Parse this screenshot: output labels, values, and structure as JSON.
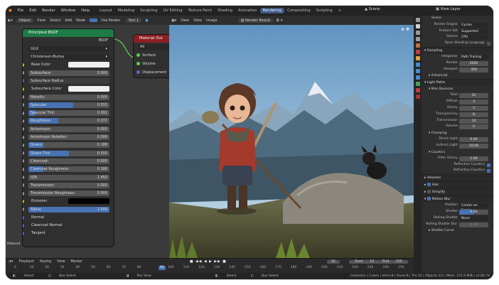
{
  "topbar": {
    "menu": [
      "File",
      "Edit",
      "Render",
      "Window",
      "Help"
    ],
    "workspaces": [
      "Layout",
      "Modeling",
      "Sculpting",
      "UV Editing",
      "Texture Paint",
      "Shading",
      "Animation",
      "Rendering",
      "Compositing",
      "Scripting"
    ],
    "active_workspace": "Rendering",
    "scene": "Scene",
    "view_layer": "View Layer"
  },
  "node_toolbar": {
    "object": "Object",
    "items": [
      "View",
      "Select",
      "Add",
      "Node"
    ],
    "use_nodes": "Use Nodes",
    "slot": "Slot 1"
  },
  "viewport_toolbar": {
    "items": [
      "View",
      "View",
      "Image"
    ],
    "render_result": "Render Result"
  },
  "bsdf_node": {
    "title": "Principled BSDF",
    "output": "BSDF",
    "dropdowns": [
      "GGX",
      "Christensen-Burley"
    ],
    "rows": [
      {
        "type": "color",
        "label": "Base Color",
        "socket": "#c7c729",
        "color": "#f0f0f0"
      },
      {
        "type": "field",
        "label": "Subsurface:",
        "value": "0.000",
        "fill": 0,
        "socket": "#a1a1a1"
      },
      {
        "type": "dd",
        "label": "Subsurface Radius",
        "socket": "#6363c7"
      },
      {
        "type": "color",
        "label": "Subsurface Color",
        "socket": "#c7c729",
        "color": "#f0f0f0"
      },
      {
        "type": "field",
        "label": "Metallic:",
        "value": "0.000",
        "fill": 0,
        "socket": "#a1a1a1"
      },
      {
        "type": "field",
        "label": "Specular:",
        "value": "0.555",
        "fill": 0.555,
        "socket": "#a1a1a1"
      },
      {
        "type": "field",
        "label": "Specular Tint:",
        "value": "0.091",
        "fill": 0.091,
        "socket": "#a1a1a1"
      },
      {
        "type": "field",
        "label": "Roughness:",
        "value": "0.372",
        "fill": 0.372,
        "socket": "#a1a1a1"
      },
      {
        "type": "field",
        "label": "Anisotropic:",
        "value": "0.000",
        "fill": 0,
        "socket": "#a1a1a1"
      },
      {
        "type": "field",
        "label": "Anisotropic Rotation:",
        "value": "0.000",
        "fill": 0,
        "socket": "#a1a1a1"
      },
      {
        "type": "field",
        "label": "Sheen:",
        "value": "0.188",
        "fill": 0.188,
        "socket": "#a1a1a1"
      },
      {
        "type": "field",
        "label": "Sheen Tint:",
        "value": "0.500",
        "fill": 0.5,
        "socket": "#a1a1a1"
      },
      {
        "type": "field",
        "label": "Clearcoat:",
        "value": "0.000",
        "fill": 0,
        "socket": "#a1a1a1"
      },
      {
        "type": "field",
        "label": "Clearcoat Roughness:",
        "value": "0.186",
        "fill": 0.186,
        "socket": "#a1a1a1"
      },
      {
        "type": "field",
        "label": "IOR:",
        "value": "1.450",
        "fill": 0,
        "socket": "#a1a1a1"
      },
      {
        "type": "field",
        "label": "Transmission:",
        "value": "0.000",
        "fill": 0,
        "socket": "#a1a1a1"
      },
      {
        "type": "field",
        "label": "Transmission Roughness:",
        "value": "0.000",
        "fill": 0,
        "socket": "#a1a1a1"
      },
      {
        "type": "color",
        "label": "Emission",
        "socket": "#c7c729",
        "color": "#000000"
      },
      {
        "type": "field",
        "label": "Alpha:",
        "value": "1.000",
        "fill": 1,
        "socket": "#a1a1a1"
      },
      {
        "type": "plain",
        "label": "Normal",
        "socket": "#6363c7"
      },
      {
        "type": "plain",
        "label": "Clearcoat Normal",
        "socket": "#6363c7"
      },
      {
        "type": "plain",
        "label": "Tangent",
        "socket": "#6363c7"
      }
    ]
  },
  "material_output": {
    "title": "Material Out",
    "target": "All",
    "sockets": [
      "Surface",
      "Volume",
      "Displacement"
    ]
  },
  "timeline": {
    "items": [
      "Playback",
      "Keying",
      "View",
      "Marker"
    ],
    "current": "92",
    "start_label": "Start",
    "start": "10",
    "end_label": "End",
    "end": "200",
    "ticks": [
      "0",
      "10",
      "20",
      "30",
      "40",
      "50",
      "60",
      "70",
      "80",
      "92",
      "100",
      "110",
      "120",
      "130",
      "140",
      "150",
      "160",
      "170",
      "180",
      "190",
      "200",
      "210",
      "220",
      "230",
      "240",
      "250"
    ]
  },
  "status": {
    "left": [
      "Select",
      "Box Select",
      "Pan View",
      "Select",
      "Box Select"
    ],
    "right": "Collection | Cubes | Verts:8 | Faces:6 | Tris:12 | Objects:1/3 | Mem: 155.9 MiB | v2.80.74"
  },
  "side_label": "Material",
  "props": {
    "scene": "Scene",
    "render_engine_label": "Render Engine",
    "render_engine": "Cycles",
    "feature_set_label": "Feature Set",
    "feature_set": "Supported",
    "device_label": "Device",
    "device": "CPU",
    "osl_label": "Open Shading Language",
    "sampling": "Sampling",
    "integrator_label": "Integrator",
    "integrator": "Path Tracing",
    "render_label": "Render",
    "render": "3500",
    "viewport_label": "Viewport",
    "viewport": "300",
    "advanced": "Advanced",
    "light_paths": "Light Paths",
    "max_bounces": "Max Bounces",
    "bounces": [
      {
        "label": "Total",
        "value": "32"
      },
      {
        "label": "Diffuse",
        "value": "3"
      },
      {
        "label": "Glossy",
        "value": "3"
      },
      {
        "label": "Transparency",
        "value": "8"
      },
      {
        "label": "Transmission",
        "value": "12"
      },
      {
        "label": "Volume",
        "value": "0"
      }
    ],
    "clamping": "Clamping",
    "direct_label": "Direct Light",
    "direct": "0.00",
    "indirect_label": "Indirect Light",
    "indirect": "10.00",
    "caustics": "Caustics",
    "filter_glossy_label": "Filter Glossy",
    "filter_glossy": "1.00",
    "reflective_label": "Reflective Caustics",
    "refractive_label": "Refractive Caustics",
    "volumes": "Volumes",
    "hair": "Hair",
    "simplify": "Simplify",
    "motion_blur": "Motion Blur",
    "position_label": "Position",
    "position": "Center on Frame",
    "shutter_label": "Shutter",
    "shutter": "0.50",
    "rolling_label": "Rolling Shutter",
    "rolling": "None",
    "rolling_dur_label": "Rolling Shutter Dur.",
    "rolling_dur": "0.10",
    "shutter_curve": "Shutter Curve"
  },
  "colors": {
    "accent": "#4772b3",
    "bsdf_header": "#1f7a45",
    "output_header": "#8c1f25",
    "panel": "#2e2e2e"
  }
}
